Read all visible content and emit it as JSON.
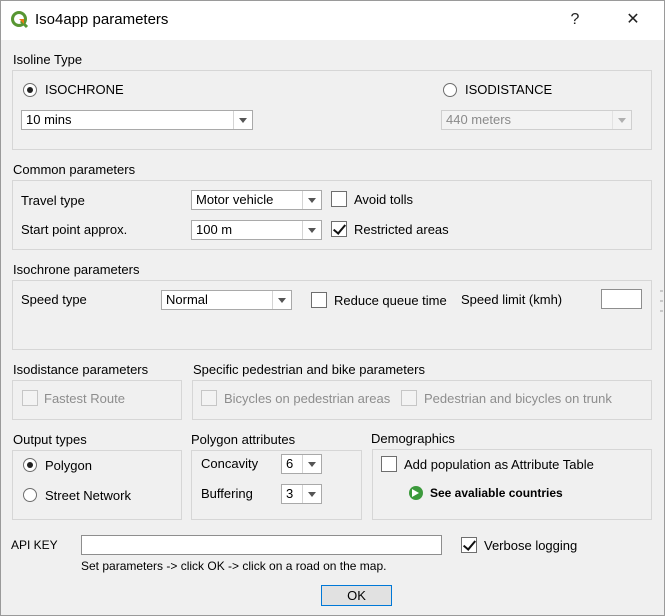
{
  "window": {
    "title": "Iso4app parameters",
    "help_label": "?",
    "close_label": "✕"
  },
  "isoline_type": {
    "group_label": "Isoline Type",
    "isochrone_label": "ISOCHRONE",
    "isochrone_checked": true,
    "isochrone_value": "10 mins",
    "isodistance_label": "ISODISTANCE",
    "isodistance_checked": false,
    "isodistance_value": "440 meters"
  },
  "common": {
    "group_label": "Common parameters",
    "travel_type_label": "Travel type",
    "travel_type_value": "Motor vehicle",
    "avoid_tolls_label": "Avoid tolls",
    "avoid_tolls_checked": false,
    "start_point_label": "Start point approx.",
    "start_point_value": "100 m",
    "restricted_areas_label": "Restricted areas",
    "restricted_areas_checked": true
  },
  "isochrone": {
    "group_label": "Isochrone parameters",
    "speed_type_label": "Speed type",
    "speed_type_value": "Normal",
    "reduce_queue_label": "Reduce queue time",
    "reduce_queue_checked": false,
    "speed_limit_label": "Speed limit (kmh)",
    "speed_limit_value": ""
  },
  "isodistance": {
    "group_label": "Isodistance parameters",
    "fastest_route_label": "Fastest Route",
    "fastest_route_checked": false
  },
  "pedestrian": {
    "group_label": "Specific pedestrian and bike parameters",
    "bicycles_label": "Bicycles on pedestrian areas",
    "trunk_label": "Pedestrian and bicycles on trunk"
  },
  "output": {
    "group_label": "Output types",
    "polygon_label": "Polygon",
    "polygon_checked": true,
    "street_label": "Street Network",
    "street_checked": false
  },
  "polygon_attrs": {
    "group_label": "Polygon attributes",
    "concavity_label": "Concavity",
    "concavity_value": "6",
    "buffering_label": "Buffering",
    "buffering_value": "3"
  },
  "demographics": {
    "group_label": "Demographics",
    "add_population_label": "Add population as Attribute Table",
    "add_population_checked": false,
    "countries_link": "See avaliable countries"
  },
  "footer": {
    "api_key_label": "API KEY",
    "api_key_value": "",
    "verbose_label": "Verbose logging",
    "verbose_checked": true,
    "instructions": "Set parameters -> click OK -> click on a road on the map.",
    "ok_label": "OK"
  },
  "colors": {
    "accent": "#0078d7",
    "qgis_green": "#589632",
    "qgis_yellow": "#ee7913",
    "link_icon": "#3c9a3c"
  }
}
